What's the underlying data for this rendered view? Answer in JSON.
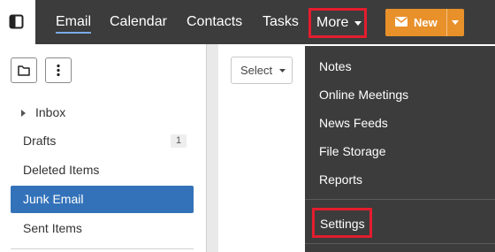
{
  "nav": {
    "items": [
      {
        "label": "Email"
      },
      {
        "label": "Calendar"
      },
      {
        "label": "Contacts"
      },
      {
        "label": "Tasks"
      }
    ],
    "more_label": "More",
    "new_label": "New"
  },
  "sidebar": {
    "folders": [
      {
        "label": "Inbox",
        "badge": ""
      },
      {
        "label": "Drafts",
        "badge": "1"
      },
      {
        "label": "Deleted Items",
        "badge": ""
      },
      {
        "label": "Junk Email",
        "badge": ""
      },
      {
        "label": "Sent Items",
        "badge": ""
      }
    ]
  },
  "main": {
    "select_label": "Select"
  },
  "more_menu": {
    "items": [
      {
        "label": "Notes"
      },
      {
        "label": "Online Meetings"
      },
      {
        "label": "News Feeds"
      },
      {
        "label": "File Storage"
      },
      {
        "label": "Reports"
      }
    ],
    "settings_label": "Settings"
  },
  "colors": {
    "topbar": "#3c3c3c",
    "accent_new": "#e8902a",
    "selected_folder": "#3372b9",
    "highlight": "#e31d2e"
  },
  "icons": {
    "panel_toggle": "panel-toggle-icon",
    "new_folder": "folder-icon",
    "more_options": "kebab-icon",
    "new_mail": "envelope-icon"
  }
}
